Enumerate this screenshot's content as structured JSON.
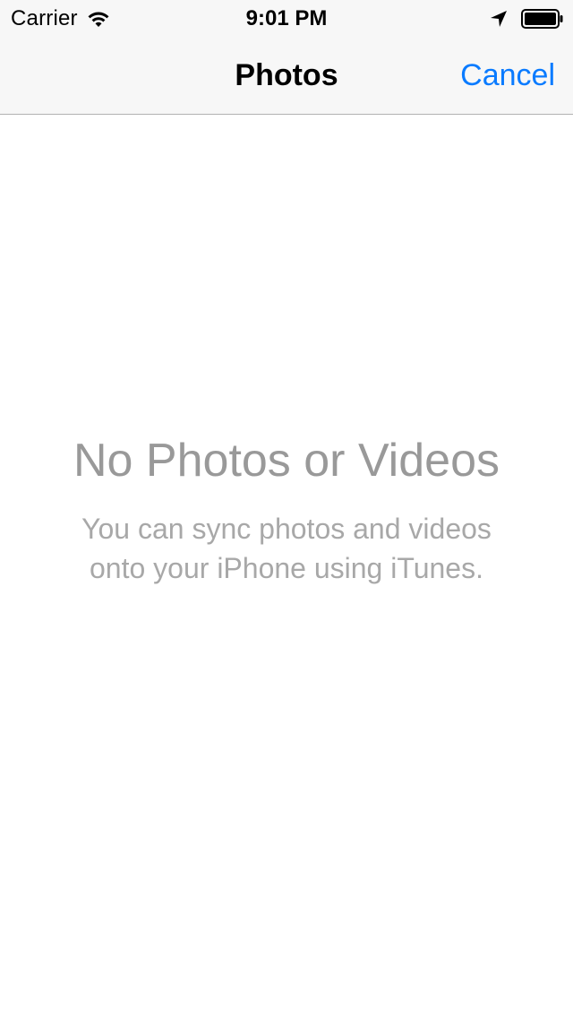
{
  "status_bar": {
    "carrier": "Carrier",
    "time": "9:01 PM",
    "icons": [
      "wifi-icon",
      "location-arrow-icon",
      "battery-icon"
    ]
  },
  "nav_bar": {
    "title": "Photos",
    "cancel_label": "Cancel"
  },
  "empty_state": {
    "title": "No Photos or Videos",
    "message_line1": "You can sync photos and videos",
    "message_line2": "onto your iPhone using iTunes."
  },
  "colors": {
    "accent": "#0a7bff",
    "nav_background": "#f7f7f7",
    "empty_text": "#999999"
  }
}
